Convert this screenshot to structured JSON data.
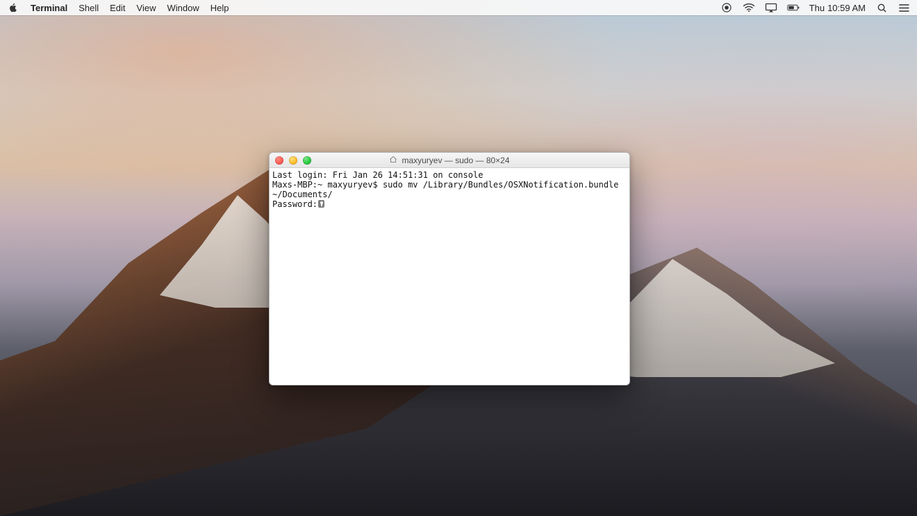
{
  "menubar": {
    "app": "Terminal",
    "items": [
      "Shell",
      "Edit",
      "View",
      "Window",
      "Help"
    ],
    "status": {
      "day": "Thu",
      "time": "10:59 AM"
    }
  },
  "window": {
    "title": "maxyuryev — sudo — 80×24",
    "lines": {
      "l0": "Last login: Fri Jan 26 14:51:31 on console",
      "l1": "Maxs-MBP:~ maxyuryev$ sudo mv /Library/Bundles/OSXNotification.bundle ~/Documents/",
      "l2": "Password:"
    }
  }
}
